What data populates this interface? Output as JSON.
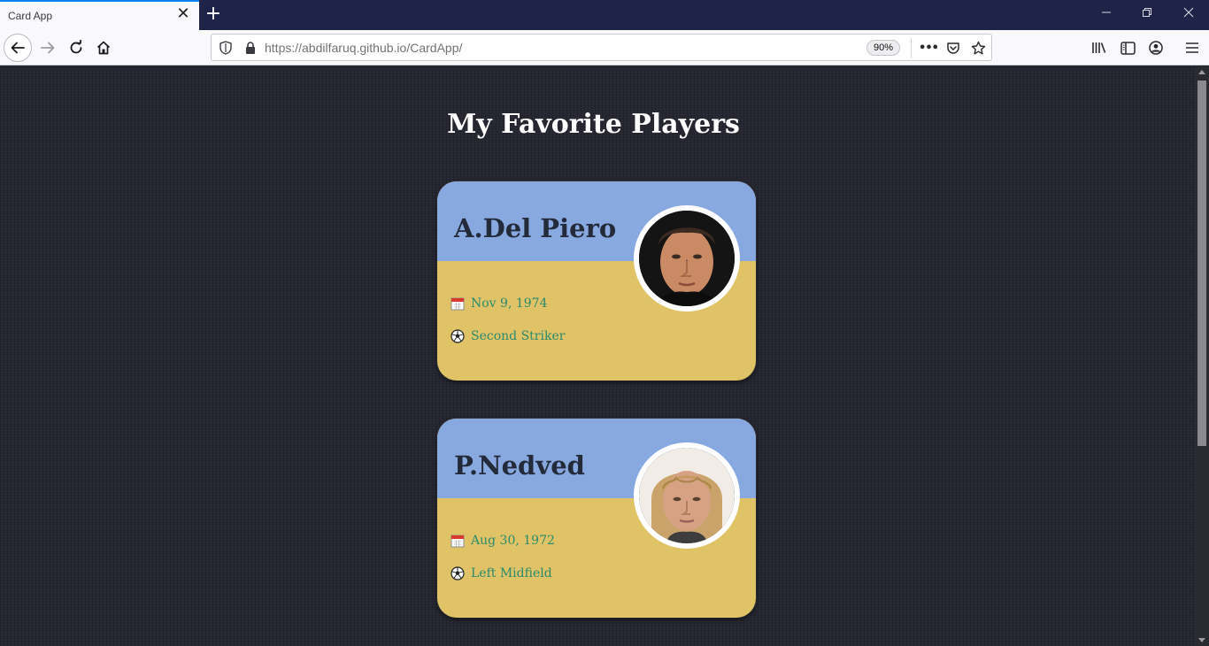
{
  "browser": {
    "tab_title": "Card App",
    "tab_close": "✕",
    "new_tab": "+",
    "url_host": "https://abdilfaruq.github.io",
    "url_path": "/CardApp/",
    "zoom": "90%",
    "more": "•••"
  },
  "page": {
    "title": "My Favorite Players"
  },
  "players": [
    {
      "name": "A.Del Piero",
      "birth": "Nov 9, 1974",
      "position": "Second Striker"
    },
    {
      "name": "P.Nedved",
      "birth": "Aug 30, 1972",
      "position": "Left Midfield"
    }
  ],
  "colors": {
    "card_top": "#88a8e0",
    "card_bottom": "#dfc366",
    "info_text": "#2b8a6d",
    "name_text": "#232a3a",
    "background": "#262631"
  }
}
